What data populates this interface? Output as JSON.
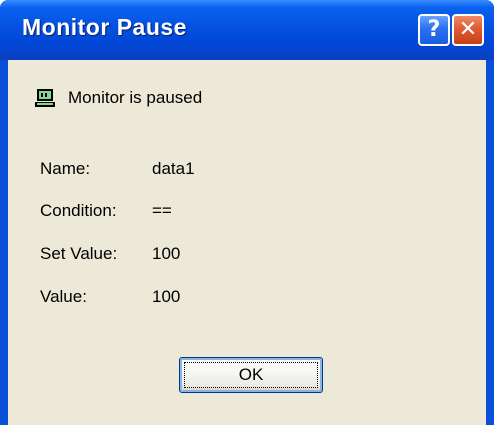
{
  "window": {
    "title": "Monitor Pause",
    "help_glyph": "?",
    "close_glyph": "✕"
  },
  "status": {
    "icon": "monitor-icon",
    "text": "Monitor is paused"
  },
  "fields": [
    {
      "label": "Name:",
      "value": "data1"
    },
    {
      "label": "Condition:",
      "value": "=="
    },
    {
      "label": "Set Value:",
      "value": "100"
    },
    {
      "label": "Value:",
      "value": "100"
    }
  ],
  "buttons": {
    "ok_label": "OK"
  },
  "colors": {
    "titlebar": "#0553e2",
    "client_bg": "#ece9d8",
    "close_button": "#e25a31",
    "monitor_icon_screen": "#7fd88a"
  }
}
